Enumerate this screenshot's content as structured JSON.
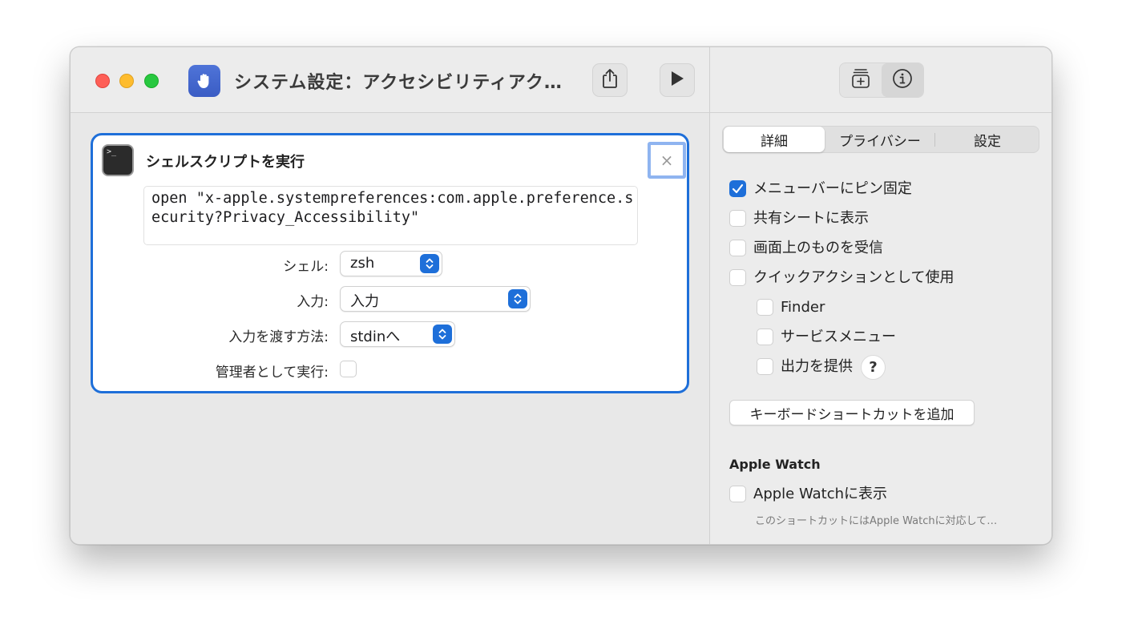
{
  "window": {
    "title": "システム設定：アクセシビリティアク…"
  },
  "toolbar": {
    "share_icon": "share-icon",
    "run_icon": "play-icon",
    "library_icon": "add-to-library-icon",
    "info_icon": "info-icon"
  },
  "action": {
    "title": "シェルスクリプトを実行",
    "icon": "terminal-icon",
    "terminal_glyph": ">_",
    "close_glyph": "×",
    "script": "open \"x-apple.systempreferences:com.apple.preference.security?Privacy_Accessibility\"",
    "fields": {
      "shell_label": "シェル:",
      "shell_value": "zsh",
      "input_label": "入力:",
      "input_value": "入力",
      "pass_label": "入力を渡す方法:",
      "pass_value": "stdinへ",
      "admin_label": "管理者として実行:",
      "admin_checked": false
    }
  },
  "inspector": {
    "tabs": [
      "詳細",
      "プライバシー",
      "設定"
    ],
    "active_tab": "詳細",
    "options": [
      {
        "label": "メニューバーにピン固定",
        "checked": true
      },
      {
        "label": "共有シートに表示",
        "checked": false
      },
      {
        "label": "画面上のものを受信",
        "checked": false
      },
      {
        "label": "クイックアクションとして使用",
        "checked": false
      },
      {
        "label": "Finder",
        "checked": false
      },
      {
        "label": "サービスメニュー",
        "checked": false
      },
      {
        "label": "出力を提供",
        "checked": false
      }
    ],
    "help_label": "?",
    "keyboard_shortcut_button": "キーボードショートカットを追加",
    "watch_section_title": "Apple Watch",
    "watch_option": {
      "label": "Apple Watchに表示",
      "checked": false
    },
    "watch_note": "このショートカットにはApple Watchに対応して…"
  },
  "colors": {
    "accent": "#1e6fd9",
    "traffic_red": "#fe5f57",
    "traffic_yellow": "#febc2e",
    "traffic_green": "#28c840"
  }
}
